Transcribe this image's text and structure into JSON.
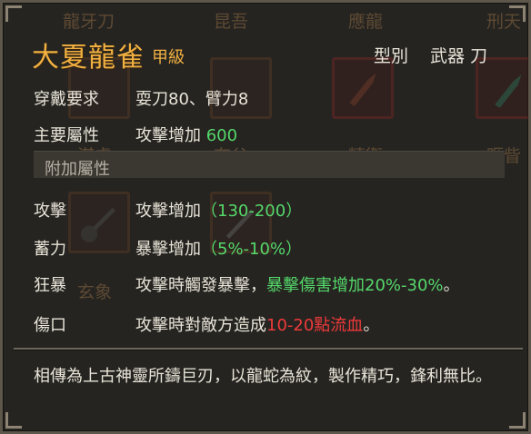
{
  "tooltip": {
    "title": "大夏龍雀",
    "grade": "甲級",
    "type_label": "型別",
    "type_value": "武器 刀",
    "requirement": {
      "label": "穿戴要求",
      "value": "耍刀80、臂力8"
    },
    "primary": {
      "label": "主要屬性",
      "text": "攻擊增加 ",
      "value": "600"
    },
    "section_title": "附加屬性",
    "attributes": [
      {
        "label": "攻擊",
        "text": "攻擊增加",
        "value": "（130-200）"
      },
      {
        "label": "蓄力",
        "text": "暴擊增加",
        "value": "（5%-10%）"
      },
      {
        "label": "狂暴",
        "text": "攻擊時觸發暴擊，",
        "value": "暴擊傷害增加20%-30%",
        "suffix": "。"
      },
      {
        "label": "傷口",
        "text": "攻擊時對敵方造成",
        "value": "10-20點流血",
        "suffix": "。"
      }
    ],
    "description": "相傳為上古神靈所鑄巨刃，以龍蛇為紋，製作精巧，鋒利無比。"
  },
  "background_items": {
    "labels": [
      "龍牙刀",
      "昆吾",
      "應龍",
      "刑天",
      "湛盧",
      "夸父",
      "精衛",
      "睚眥",
      "玄象"
    ]
  },
  "colors": {
    "title": "#f0b040",
    "text": "#e8e4d8",
    "green": "#54d86a",
    "red": "#ee3a3a",
    "panel": "#262421",
    "border": "#5d564b"
  }
}
